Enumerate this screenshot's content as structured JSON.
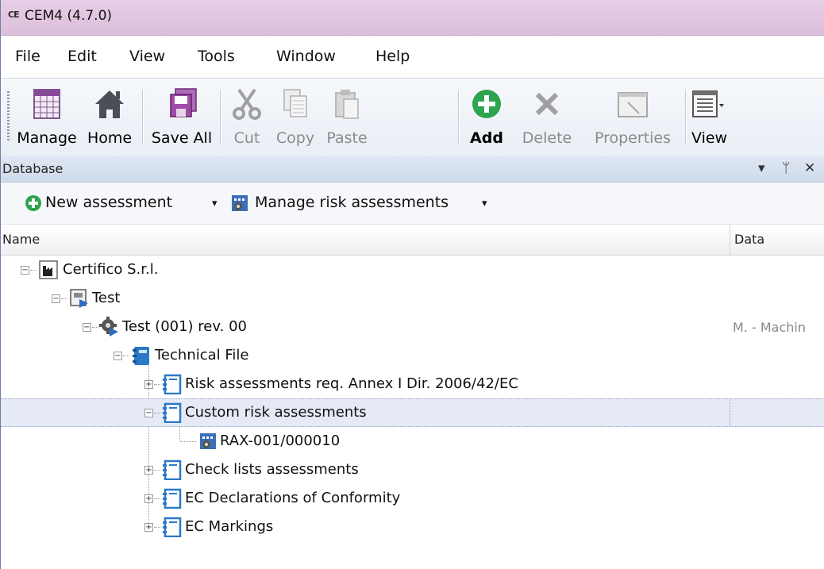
{
  "window": {
    "title": "CEM4 (4.7.0)",
    "app_icon": "CE"
  },
  "menu": [
    "File",
    "Edit",
    "View",
    "Tools",
    "Window",
    "Help"
  ],
  "toolbar": {
    "manage": "Manage",
    "home": "Home",
    "save_all": "Save All",
    "cut": "Cut",
    "copy": "Copy",
    "paste": "Paste",
    "add": "Add",
    "delete": "Delete",
    "properties": "Properties",
    "view": "View"
  },
  "panel": {
    "title": "Database",
    "dropdown": "▾",
    "pin": "ᛘ",
    "close": "✕"
  },
  "actions": {
    "new_assessment": "New assessment",
    "manage_risk": "Manage risk assessments",
    "caret": "▾"
  },
  "columns": {
    "name": "Name",
    "data": "Data"
  },
  "tree": [
    {
      "label": "Certifico S.r.l.",
      "data": ""
    },
    {
      "label": "Test",
      "data": ""
    },
    {
      "label": "Test (001) rev. 00",
      "data": "M. - Machin"
    },
    {
      "label": "Technical File",
      "data": ""
    },
    {
      "label": "Risk assessments req. Annex I Dir. 2006/42/EC",
      "data": ""
    },
    {
      "label": "Custom risk assessments",
      "data": ""
    },
    {
      "label": "RAX-001/000010",
      "data": ""
    },
    {
      "label": "Check lists assessments",
      "data": ""
    },
    {
      "label": "EC Declarations of Conformity",
      "data": ""
    },
    {
      "label": "EC Markings",
      "data": ""
    }
  ],
  "expanders": {
    "collapse": "−",
    "expand": "+"
  }
}
